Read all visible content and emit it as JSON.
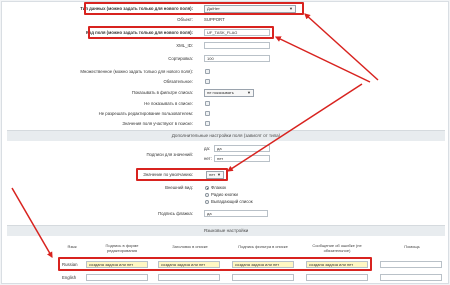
{
  "type_row": {
    "label": "Тип данных (можно задать только для нового поля):",
    "value": "Да/Нет"
  },
  "object_row": {
    "label": "Объект:",
    "value": "SUPPORT"
  },
  "code_row": {
    "label": "Код поля (можно задать только для нового поля):",
    "value": "UF_TASK_FLAG"
  },
  "xml_row": {
    "label": "XML_ID:",
    "value": ""
  },
  "sort_row": {
    "label": "Сортировка:",
    "value": "100"
  },
  "multiple_row": {
    "label": "Множественное (можно задать только для нового поля):"
  },
  "required_row": {
    "label": "Обязательное:"
  },
  "filter_row": {
    "label": "Показывать в фильтре списка:",
    "value": "не показывать"
  },
  "hide_list_row": {
    "label": "Не показывать в списке:"
  },
  "no_edit_row": {
    "label": "Не разрешать редактирование пользователем:"
  },
  "search_row": {
    "label": "Значения поля участвуют в поиске:"
  },
  "section_extra": {
    "title": "Дополнительные настройки поля (зависят от типа)"
  },
  "labels_row": {
    "label": "Подписи для значений:",
    "yes_prefix": "да:",
    "yes_value": "да",
    "no_prefix": "нет:",
    "no_value": "нет"
  },
  "default_row": {
    "label": "Значение по умолчанию:",
    "value": "нет"
  },
  "view_row": {
    "label": "Внешний вид:",
    "options": [
      "Флажок",
      "Радио кнопки",
      "Выпадающий список"
    ]
  },
  "flag_label_row": {
    "label": "Подпись флажка:",
    "value": "да"
  },
  "section_lang": {
    "title": "Языковые настройки"
  },
  "lang_table": {
    "headers": [
      "Язык",
      "Подпись в форме редактирования",
      "Заголовок в списке",
      "Подпись фильтра в списке",
      "Сообщение об ошибке (не обязательное)",
      "Помощь"
    ],
    "rows": [
      {
        "lang": "Russian",
        "cells": [
          "создана задача или нет",
          "создана задача или нет",
          "создана задача или нет",
          "создана задача или нет",
          ""
        ]
      },
      {
        "lang": "English",
        "cells": [
          "",
          "",
          "",
          "",
          ""
        ]
      }
    ]
  },
  "colors": {
    "highlight": "#d8231f",
    "yellow_fill": "#fff7c2",
    "section_bg": "#e8ecef"
  }
}
